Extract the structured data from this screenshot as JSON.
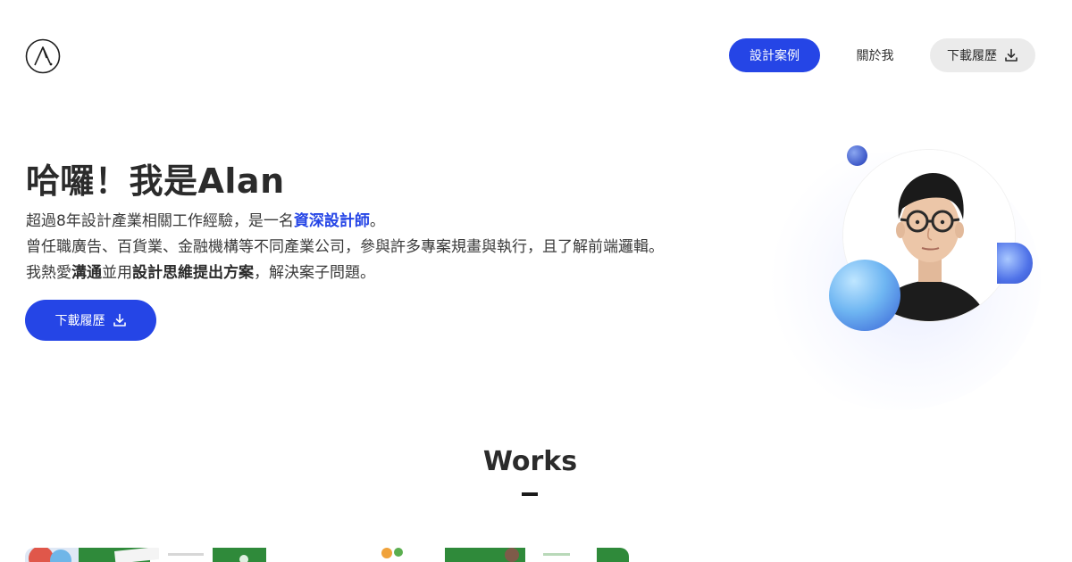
{
  "logo": {
    "icon": "alan-logo-icon"
  },
  "nav": {
    "items": [
      {
        "label": "設計案例",
        "active": true
      },
      {
        "label": "關於我",
        "active": false
      },
      {
        "label": "下載履歷",
        "active": false,
        "icon": "download-icon"
      }
    ]
  },
  "hero": {
    "title": "哈囉！我是Alan",
    "line1_pre": "超過8年設計產業相關工作經驗，是一名",
    "line1_highlight": "資深設計師",
    "line1_post": "。",
    "line2": "曾任職廣告、百貨業、金融機構等不同產業公司，參與許多專案規畫與執行，且了解前端邏輯。",
    "line3_a": "我熱愛",
    "line3_b": "溝通",
    "line3_c": "並用",
    "line3_d": "設計思維提出方案",
    "line3_e": "，解決案子問題。",
    "button_label": "下載履歷",
    "button_icon": "download-icon"
  },
  "works": {
    "title": "Works"
  },
  "colors": {
    "accent": "#2545e6",
    "text": "#2b2b2b",
    "grey_button": "#ebebeb",
    "works_green": "#2f8a3a"
  }
}
